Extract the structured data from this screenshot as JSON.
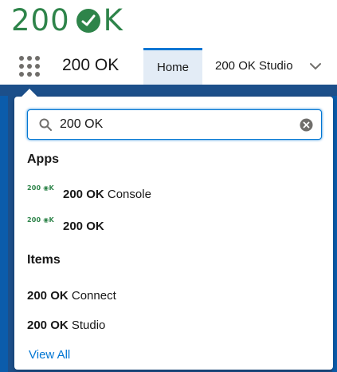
{
  "brand": {
    "logo_prefix": "200",
    "logo_suffix": "K",
    "brand_color": "#2e844a"
  },
  "nav": {
    "app_name": "200 OK",
    "tabs": [
      {
        "label": "Home",
        "active": true
      },
      {
        "label": "200 OK Studio",
        "active": false
      }
    ]
  },
  "search": {
    "value": "200 OK",
    "placeholder": ""
  },
  "apps_section": {
    "title": "Apps",
    "items": [
      {
        "logo_text": "200 ◉K",
        "bold": "200 OK",
        "rest": " Console"
      },
      {
        "logo_text": "200 ◉K",
        "bold": "200 OK",
        "rest": ""
      }
    ]
  },
  "items_section": {
    "title": "Items",
    "items": [
      {
        "bold": "200 OK",
        "rest": " Connect"
      },
      {
        "bold": "200 OK",
        "rest": " Studio"
      }
    ]
  },
  "view_all_label": "View All",
  "colors": {
    "accent": "#0176d3",
    "tab_active_bg": "#e3ecf6",
    "backdrop": "#1c4f8a"
  }
}
